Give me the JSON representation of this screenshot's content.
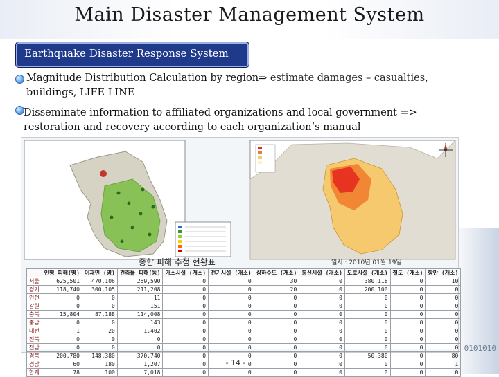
{
  "slide": {
    "title": "Main Disaster Management System",
    "badge_label": "Earthquake Disaster Response System",
    "bullets": [
      {
        "line1": "Magnitude Distribution Calculation by region",
        "arrow": "⇒",
        "line1_rest": " estimate damages – casualties,",
        "line2": "buildings, LIFE LINE"
      },
      {
        "line1": " Disseminate information to affiliated organizations and local government =>",
        "line2": "restoration and recovery according to each organization’s manual"
      }
    ],
    "page_number": "- 14 -",
    "side_keys": "0101010"
  },
  "composite": {
    "map_left_label": "",
    "table_title": "종합  피해  추정  현황표",
    "table_date": "일시 : 2010년 01월 19일",
    "table": {
      "headers": [
        "",
        "인명\n피해(명)",
        "이재민\n(명)",
        "건축물\n피해(동)",
        "가스시설\n(개소)",
        "전기시설\n(개소)",
        "상하수도\n(개소)",
        "통신시설\n(개소)",
        "도로시설\n(개소)",
        "철도\n(개소)",
        "항만\n(개소)"
      ],
      "rows": [
        [
          "서울",
          "625,501",
          "470,106",
          "259,590",
          "0",
          "0",
          "30",
          "0",
          "380,118",
          "0",
          "10"
        ],
        [
          "경기",
          "118,740",
          "300,105",
          "211,208",
          "0",
          "0",
          "20",
          "0",
          "200,100",
          "0",
          "0"
        ],
        [
          "인천",
          "0",
          "0",
          "11",
          "0",
          "0",
          "0",
          "0",
          "0",
          "0",
          "0"
        ],
        [
          "강원",
          "0",
          "0",
          "151",
          "0",
          "0",
          "0",
          "0",
          "0",
          "0",
          "0"
        ],
        [
          "충북",
          "15,804",
          "87,188",
          "114,008",
          "0",
          "0",
          "0",
          "0",
          "0",
          "0",
          "0"
        ],
        [
          "충남",
          "0",
          "0",
          "143",
          "0",
          "0",
          "0",
          "0",
          "0",
          "0",
          "0"
        ],
        [
          "대전",
          "1",
          "20",
          "1,402",
          "0",
          "0",
          "0",
          "0",
          "0",
          "0",
          "0"
        ],
        [
          "전북",
          "0",
          "0",
          "0",
          "0",
          "0",
          "0",
          "0",
          "0",
          "0",
          "0"
        ],
        [
          "전남",
          "0",
          "0",
          "0",
          "0",
          "0",
          "0",
          "0",
          "0",
          "0",
          "0"
        ],
        [
          "경북",
          "200,780",
          "148,380",
          "370,740",
          "0",
          "0",
          "0",
          "0",
          "50,380",
          "0",
          "80"
        ],
        [
          "경남",
          "60",
          "180",
          "1,207",
          "0",
          "0",
          "0",
          "0",
          "0",
          "0",
          "1"
        ],
        [
          "합계",
          "78",
          "100",
          "7,018",
          "0",
          "0",
          "0",
          "0",
          "0",
          "0",
          "0"
        ]
      ]
    }
  },
  "colors": {
    "badge_bg": "#1f3a8a",
    "map_sea": "#ffffff",
    "land_gray": "#d6d2c4",
    "land_green": "#7bc043",
    "intensity_high": "#e52b1f",
    "intensity_mid": "#f07a2a",
    "intensity_low": "#f6c96e"
  },
  "icons": [
    "bullet-dot-icon",
    "compass-icon"
  ]
}
